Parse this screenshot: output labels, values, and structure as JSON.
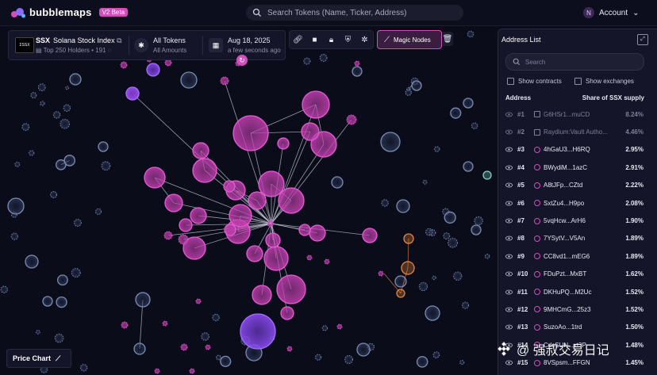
{
  "app": {
    "name": "bubblemaps",
    "badge": "V2 Beta"
  },
  "search": {
    "placeholder": "Search Tokens (Name, Ticker, Address)"
  },
  "account": {
    "initial": "N",
    "label": "Account"
  },
  "token": {
    "ticker": "SSX",
    "name": "Solana Stock Index",
    "logo_text": "ΣSSX",
    "subtitle": "Top 250 Holders • 191"
  },
  "filters": {
    "amount": {
      "title": "All Tokens",
      "subtitle": "All Amounts"
    },
    "date": {
      "title": "Aug 18, 2025",
      "subtitle": "a few seconds ago"
    }
  },
  "toolbar": {
    "magic_label": "Magic Nodes"
  },
  "address_list": {
    "title": "Address List",
    "search_placeholder": "Search",
    "show_contracts": "Show contracts",
    "show_exchanges": "Show exchanges",
    "col_address": "Address",
    "col_share": "Share of SSX supply",
    "rows": [
      {
        "rank": "#1",
        "address": "G6HSr1...muCD",
        "share": "8.24%",
        "dim": true
      },
      {
        "rank": "#2",
        "address": "Raydium:Vault Autho...",
        "share": "4.46%",
        "dim": true
      },
      {
        "rank": "#3",
        "address": "4hGaU3...H6RQ",
        "share": "2.95%",
        "dim": false
      },
      {
        "rank": "#4",
        "address": "BWydiM...1azC",
        "share": "2.91%",
        "dim": false
      },
      {
        "rank": "#5",
        "address": "A8tJFp...CZtd",
        "share": "2.22%",
        "dim": false
      },
      {
        "rank": "#6",
        "address": "SxtZu4...H9po",
        "share": "2.08%",
        "dim": false
      },
      {
        "rank": "#7",
        "address": "5vqHcw...ArH6",
        "share": "1.90%",
        "dim": false
      },
      {
        "rank": "#8",
        "address": "7YSytV...V5An",
        "share": "1.89%",
        "dim": false
      },
      {
        "rank": "#9",
        "address": "CC8vd1...mEG6",
        "share": "1.89%",
        "dim": false
      },
      {
        "rank": "#10",
        "address": "FDuPzt...MxBT",
        "share": "1.62%",
        "dim": false
      },
      {
        "rank": "#11",
        "address": "DKHuPQ...M2Uc",
        "share": "1.52%",
        "dim": false
      },
      {
        "rank": "#12",
        "address": "9MHCmG...25z3",
        "share": "1.52%",
        "dim": false
      },
      {
        "rank": "#13",
        "address": "SuzoAo...1trd",
        "share": "1.50%",
        "dim": false
      },
      {
        "rank": "#14",
        "address": "CdcSUN...xt3P",
        "share": "1.48%",
        "dim": false
      },
      {
        "rank": "#15",
        "address": "8VSpsm...FFGN",
        "share": "1.45%",
        "dim": false
      }
    ]
  },
  "price_chart": {
    "label": "Price Chart"
  },
  "watermark": {
    "text": "@ 强叔交易日记"
  },
  "colors": {
    "accent": "#d14fbd",
    "bubble": "#c23fb0",
    "other_bubble": "#5a6a90",
    "orange": "#e8873a",
    "teal": "#7fd6c4"
  }
}
